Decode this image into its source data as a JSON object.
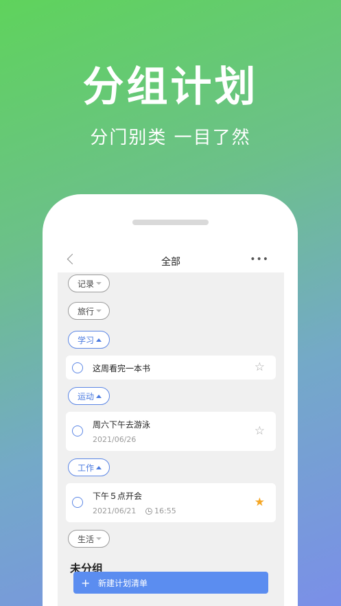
{
  "hero": {
    "title": "分组计划",
    "subtitle": "分门别类 一目了然"
  },
  "navbar": {
    "title": "全部",
    "more": "•••"
  },
  "groups": [
    {
      "label": "记录",
      "state": "collapsed"
    },
    {
      "label": "旅行",
      "state": "collapsed"
    },
    {
      "label": "学习",
      "state": "expanded"
    },
    {
      "label": "运动",
      "state": "expanded"
    },
    {
      "label": "工作",
      "state": "expanded"
    },
    {
      "label": "生活",
      "state": "collapsed"
    }
  ],
  "tasks": [
    {
      "title": "这周看完一本书",
      "date": "",
      "time": "",
      "starred": false
    },
    {
      "title": "周六下午去游泳",
      "date": "2021/06/26",
      "time": "",
      "starred": false
    },
    {
      "title": "下午５点开会",
      "date": "2021/06/21",
      "time": "16:55",
      "starred": true
    }
  ],
  "ungrouped_label": "未分组",
  "new_list_button": {
    "icon": "+",
    "label": "新建计划清单"
  },
  "colors": {
    "accent": "#5b86e5",
    "star_active": "#f5a623"
  }
}
